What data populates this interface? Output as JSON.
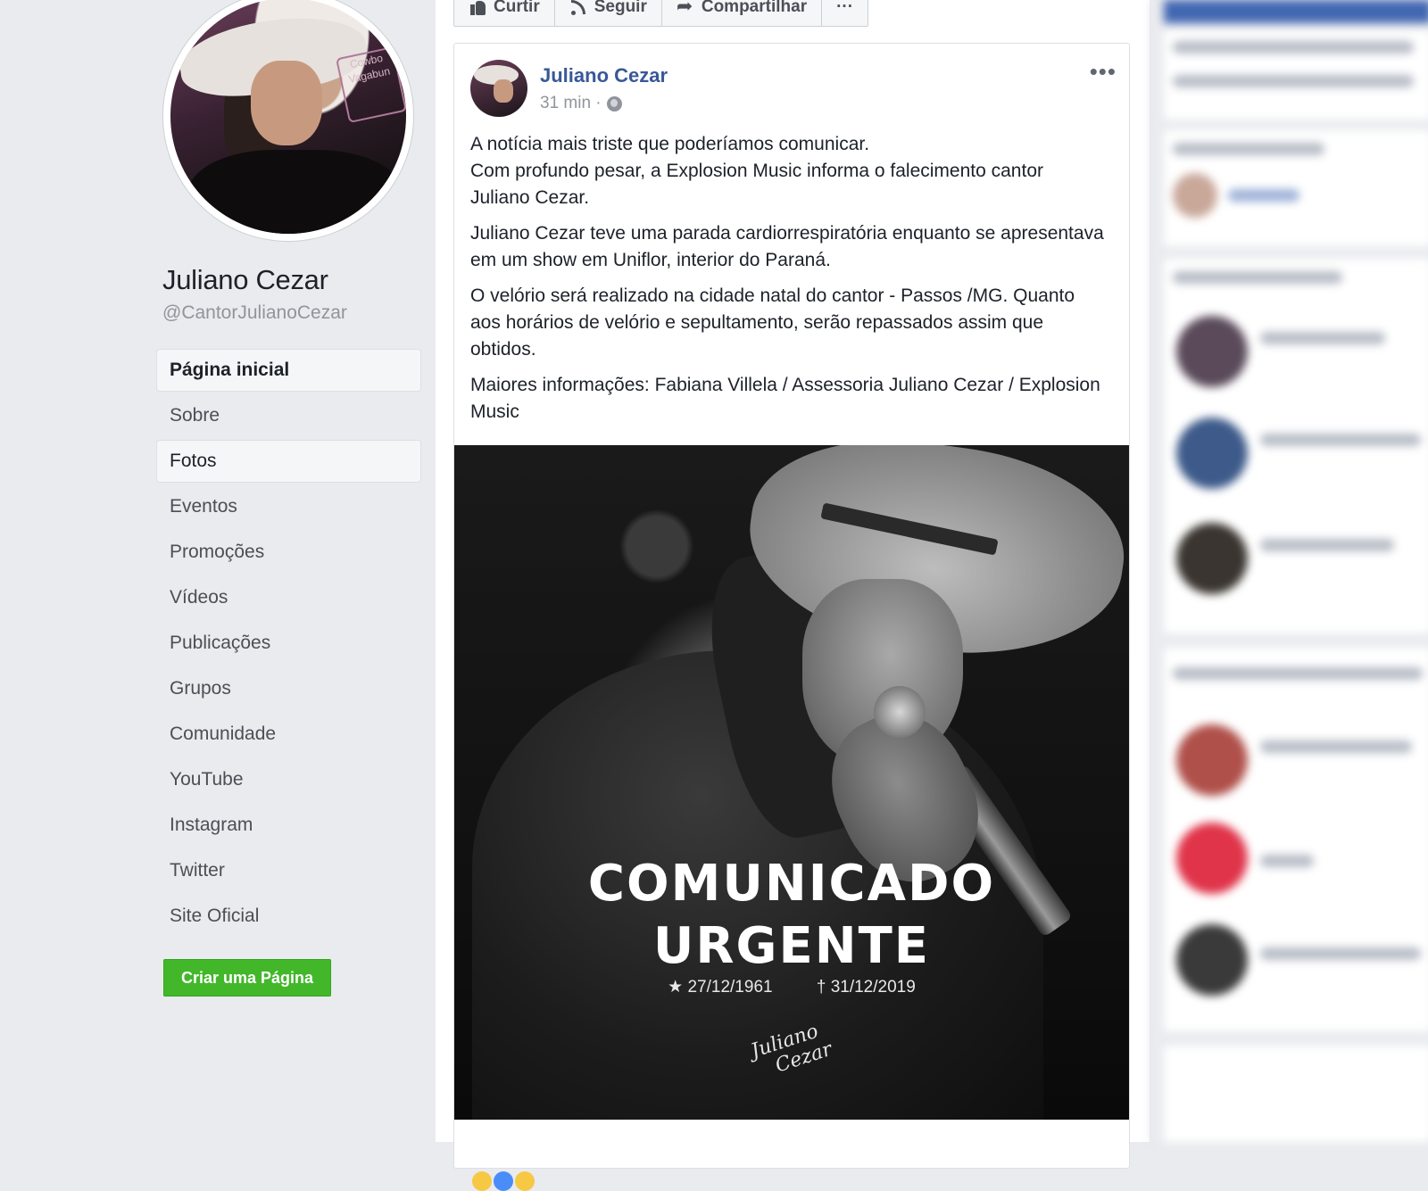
{
  "page": {
    "name": "Juliano Cezar",
    "handle": "@CantorJulianoCezar"
  },
  "actionbar": {
    "like": "Curtir",
    "follow": "Seguir",
    "share": "Compartilhar",
    "more": "···"
  },
  "nav": {
    "items": [
      {
        "label": "Página inicial"
      },
      {
        "label": "Sobre"
      },
      {
        "label": "Fotos"
      },
      {
        "label": "Eventos"
      },
      {
        "label": "Promoções"
      },
      {
        "label": "Vídeos"
      },
      {
        "label": "Publicações"
      },
      {
        "label": "Grupos"
      },
      {
        "label": "Comunidade"
      },
      {
        "label": "YouTube"
      },
      {
        "label": "Instagram"
      },
      {
        "label": "Twitter"
      },
      {
        "label": "Site Oficial"
      }
    ],
    "active_index": 0,
    "hover_index": 2,
    "create_page": "Criar uma Página"
  },
  "post": {
    "author": "Juliano Cezar",
    "time": "31 min ·",
    "more": "•••",
    "paragraphs": [
      "A notícia mais triste que poderíamos comunicar.\nCom profundo pesar, a Explosion Music informa o falecimento cantor Juliano Cezar.",
      "Juliano Cezar teve uma parada cardiorrespiratória enquanto se apresentava em um show em Uniflor, interior do Paraná.",
      "O velório será realizado na cidade natal do cantor - Passos /MG. Quanto aos horários de velório e sepultamento, serão repassados assim que obtidos.",
      "Maiores informações: Fabiana Villela / Assessoria Juliano Cezar / Explosion Music"
    ],
    "image": {
      "title_line1": "COMUNICADO",
      "title_line2": "URGENTE",
      "birth": "★ 27/12/1961",
      "death": "† 31/12/2019",
      "signature": "Juliano Cezar"
    }
  },
  "colors": {
    "brand_blue": "#385898",
    "create_green": "#42b72a",
    "background": "#e9ebee"
  }
}
